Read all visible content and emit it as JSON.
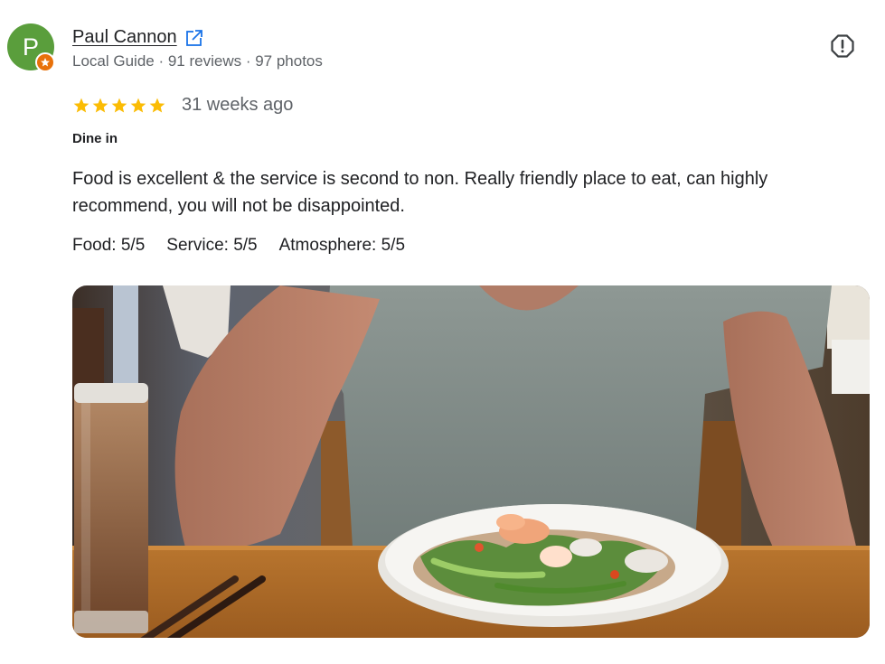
{
  "reviewer": {
    "initial": "P",
    "name": "Paul Cannon",
    "meta": "Local Guide · 91 reviews · 97 photos",
    "avatar_color": "#5a9e3c",
    "badge_color": "#e8710a"
  },
  "review": {
    "stars": 5,
    "star_color": "#fbbc04",
    "time_ago": "31 weeks ago",
    "dining_mode": "Dine in",
    "text": "Food is excellent & the service is second to non. Really friendly place to eat, can highly recommend, you will not be disappointed.",
    "sub_ratings": {
      "food": "Food: 5/5",
      "service": "Service: 5/5",
      "atmosphere": "Atmosphere: 5/5"
    }
  },
  "icons": {
    "edit": "external-link-icon",
    "report": "report-icon",
    "badge": "local-guide-star-icon"
  }
}
